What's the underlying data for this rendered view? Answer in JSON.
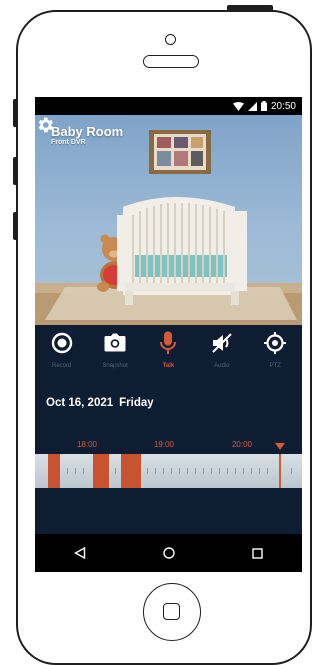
{
  "status_bar": {
    "time": "20:50",
    "icons": [
      "wifi-icon",
      "signal-icon",
      "battery-icon"
    ]
  },
  "camera": {
    "title": "Baby Room",
    "subtitle": "Front DVR",
    "settings_icon": "gear-icon"
  },
  "controls": [
    {
      "label": "Record",
      "icon": "record-icon",
      "active": false
    },
    {
      "label": "Snapshot",
      "icon": "camera-icon",
      "active": false
    },
    {
      "label": "Talk",
      "icon": "microphone-icon",
      "active": true
    },
    {
      "label": "Audio",
      "icon": "speaker-mute-icon",
      "active": false
    },
    {
      "label": "PTZ",
      "icon": "ptz-target-icon",
      "active": false
    }
  ],
  "date": {
    "date": "Oct 16, 2021",
    "weekday": "Friday"
  },
  "timeline": {
    "hours": [
      "18:00",
      "19:00",
      "20:00"
    ],
    "marker_icon": "triangle-down-icon"
  },
  "nav": {
    "back_icon": "back-triangle-icon",
    "home_icon": "home-circle-icon",
    "recents_icon": "recents-square-icon"
  },
  "colors": {
    "accent": "#d65a36",
    "screen_bg": "#0f1d33",
    "inactive_label": "#52617a"
  }
}
